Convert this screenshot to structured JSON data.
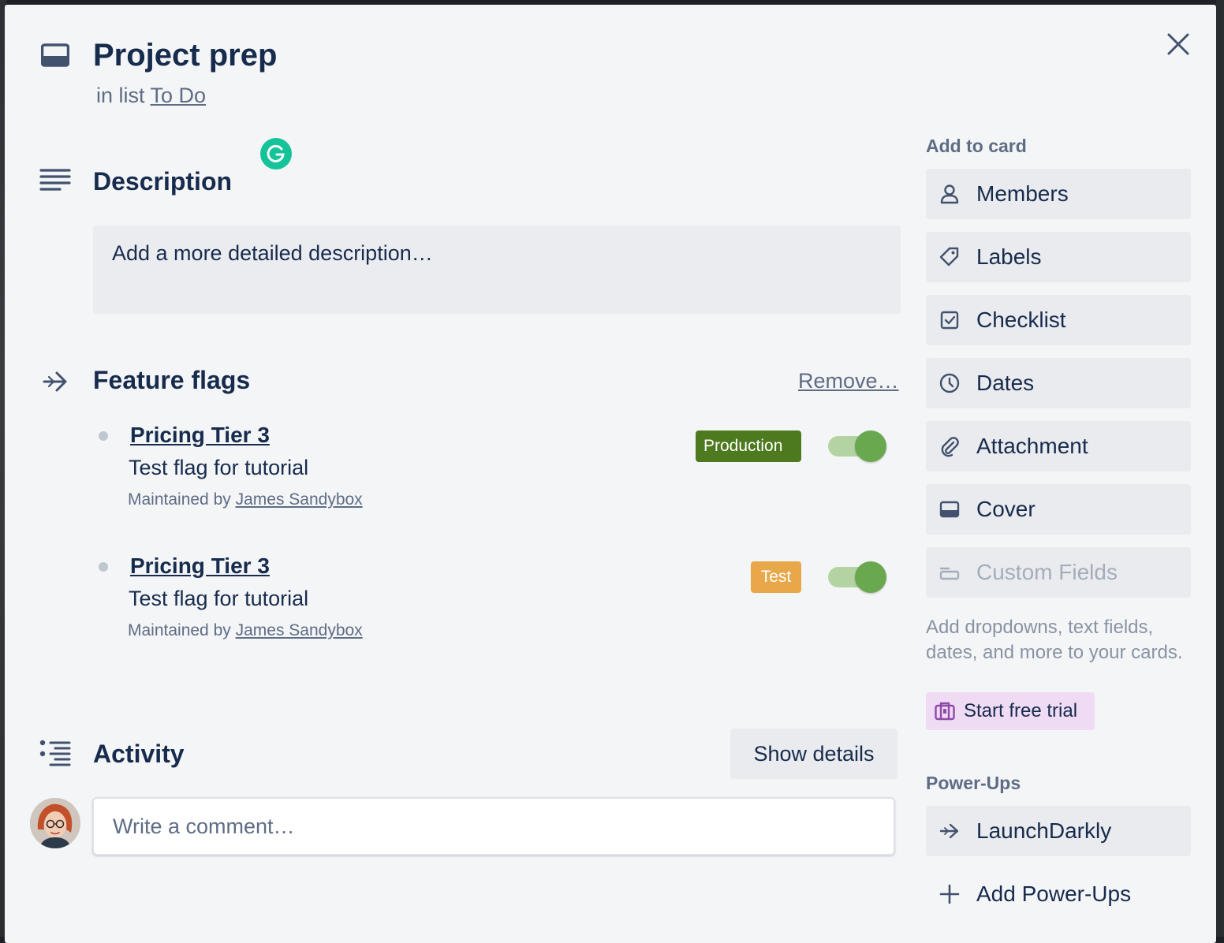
{
  "card": {
    "title": "Project prep",
    "list_prefix": "in list",
    "list_name": "To Do"
  },
  "description": {
    "heading": "Description",
    "placeholder": "Add a more detailed description…"
  },
  "feature_flags": {
    "heading": "Feature flags",
    "remove_label": "Remove…",
    "maintained_prefix": "Maintained by",
    "flags": [
      {
        "name": "Pricing Tier 3",
        "description": "Test flag for tutorial",
        "maintainer": "James Sandybox",
        "environment": "Production",
        "environment_color": "#4d7a1f",
        "enabled": true
      },
      {
        "name": "Pricing Tier 3",
        "description": "Test flag for tutorial",
        "maintainer": "James Sandybox",
        "environment": "Test",
        "environment_color": "#e8a84a",
        "enabled": true
      }
    ]
  },
  "activity": {
    "heading": "Activity",
    "show_details_label": "Show details",
    "comment_placeholder": "Write a comment…"
  },
  "sidebar": {
    "add_to_card_heading": "Add to card",
    "buttons": [
      {
        "label": "Members",
        "icon": "person-icon"
      },
      {
        "label": "Labels",
        "icon": "tag-icon"
      },
      {
        "label": "Checklist",
        "icon": "checkbox-icon"
      },
      {
        "label": "Dates",
        "icon": "clock-icon"
      },
      {
        "label": "Attachment",
        "icon": "paperclip-icon"
      },
      {
        "label": "Cover",
        "icon": "cover-icon"
      },
      {
        "label": "Custom Fields",
        "icon": "custom-fields-icon",
        "disabled": true
      }
    ],
    "custom_fields_upsell": "Add dropdowns, text fields, dates, and more to your cards.",
    "trial_label": "Start free trial",
    "powerups_heading": "Power-Ups",
    "powerups": [
      {
        "label": "LaunchDarkly",
        "icon": "launchdarkly-arrow-icon"
      }
    ],
    "add_powerups_label": "Add Power-Ups"
  },
  "colors": {
    "background": "#f4f5f7",
    "button": "#e9ebee",
    "toggle_on": "#6aa84f",
    "trial_bg": "#efdbf4",
    "grammarly": "#15c39a"
  }
}
